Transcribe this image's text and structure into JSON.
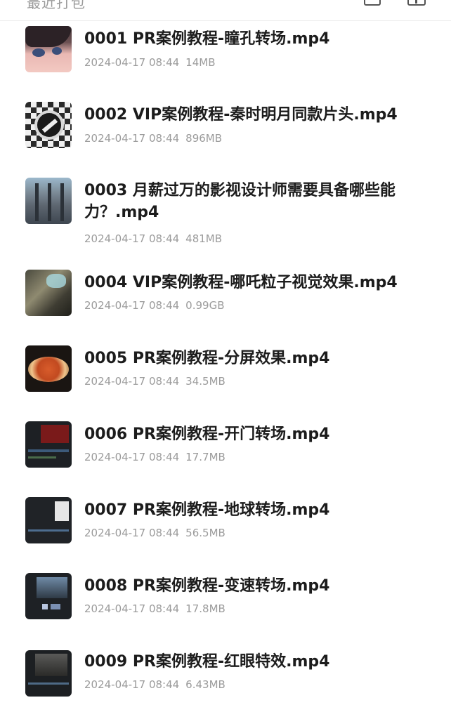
{
  "header": {
    "partial_title": "最近打包",
    "icons": [
      "list-view-icon",
      "grid-view-icon"
    ]
  },
  "files": [
    {
      "name": "0001 PR案例教程-瞳孔转场.mp4",
      "date": "2024-04-17 08:44",
      "size": "14MB"
    },
    {
      "name": "0002 VIP案例教程-秦时明月同款片头.mp4",
      "date": "2024-04-17 08:44",
      "size": "896MB"
    },
    {
      "name": "0003 月薪过万的影视设计师需要具备哪些能力？.mp4",
      "date": "2024-04-17 08:44",
      "size": "481MB"
    },
    {
      "name": "0004 VIP案例教程-哪吒粒子视觉效果.mp4",
      "date": "2024-04-17 08:44",
      "size": "0.99GB"
    },
    {
      "name": "0005 PR案例教程-分屏效果.mp4",
      "date": "2024-04-17 08:44",
      "size": "34.5MB"
    },
    {
      "name": "0006 PR案例教程-开门转场.mp4",
      "date": "2024-04-17 08:44",
      "size": "17.7MB"
    },
    {
      "name": "0007 PR案例教程-地球转场.mp4",
      "date": "2024-04-17 08:44",
      "size": "56.5MB"
    },
    {
      "name": "0008 PR案例教程-变速转场.mp4",
      "date": "2024-04-17 08:44",
      "size": "17.8MB"
    },
    {
      "name": "0009 PR案例教程-红眼特效.mp4",
      "date": "2024-04-17 08:44",
      "size": "6.43MB"
    }
  ]
}
